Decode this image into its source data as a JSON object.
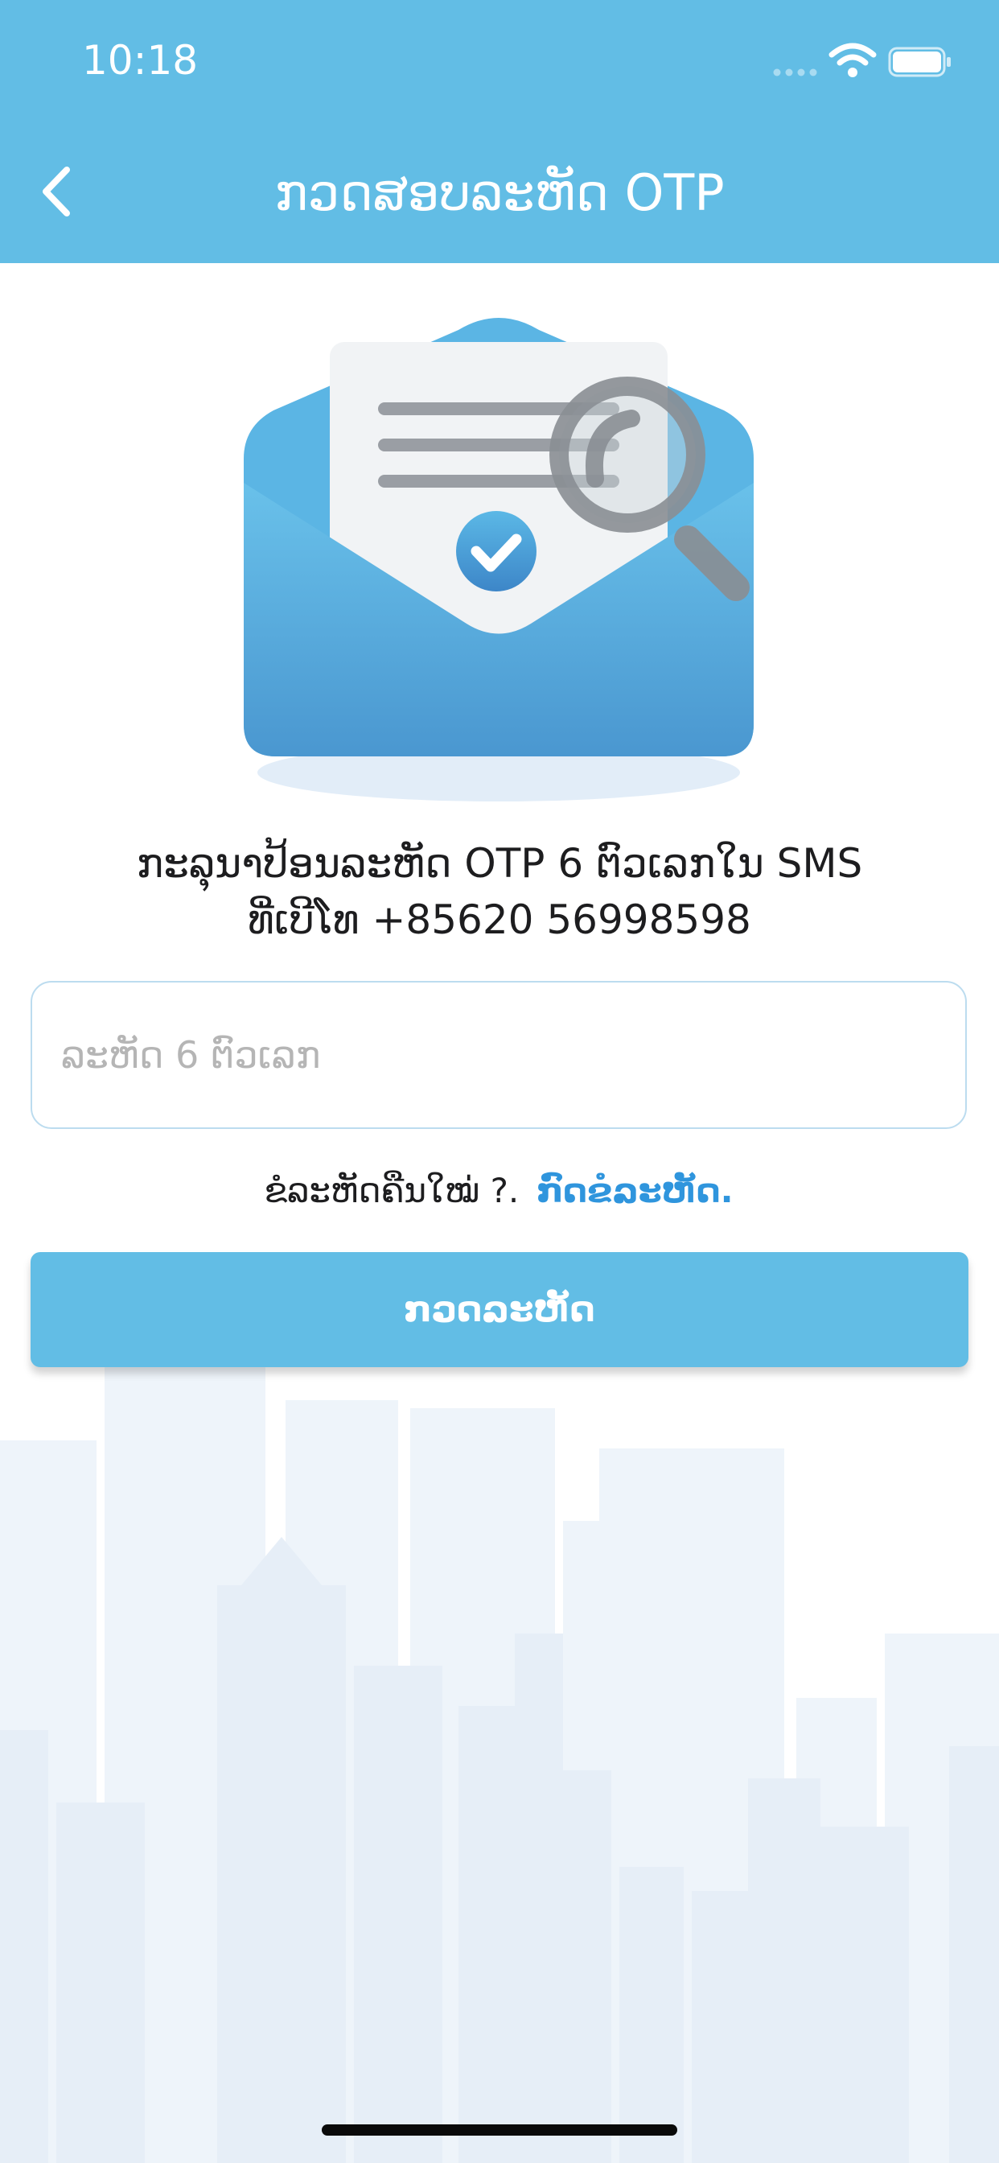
{
  "status_bar": {
    "time": "10:18",
    "icons": [
      "cellular-signal-icon",
      "wifi-icon",
      "battery-icon"
    ]
  },
  "header": {
    "title": "ກວດສອບລະຫັດ OTP",
    "back_icon": "chevron-left-icon"
  },
  "main": {
    "illustration_icon": "envelope-document-check-magnifier-icon",
    "instruction_line1": "ກະລຸນາປ້ອນລະຫັດ OTP 6 ຕົວເລກໃນ SMS",
    "instruction_line2": "ທີ່ເບີໂທ +85620 56998598",
    "otp_input": {
      "placeholder": "ລະຫັດ 6 ຕົວເລກ",
      "value": ""
    },
    "resend_question": "ຂໍລະຫັດຄືນໃໝ່ ?.",
    "resend_link": "ກົດຂໍລະຫັດ.",
    "verify_button": "ກວດລະຫັດ"
  },
  "colors": {
    "header_bg": "#62bde5",
    "button_bg": "#62bde5",
    "link": "#2f95dd",
    "input_border": "#bcdcef",
    "placeholder": "#b5b5b5",
    "text": "#1d1d1f",
    "skyline": "#eef4fa"
  }
}
